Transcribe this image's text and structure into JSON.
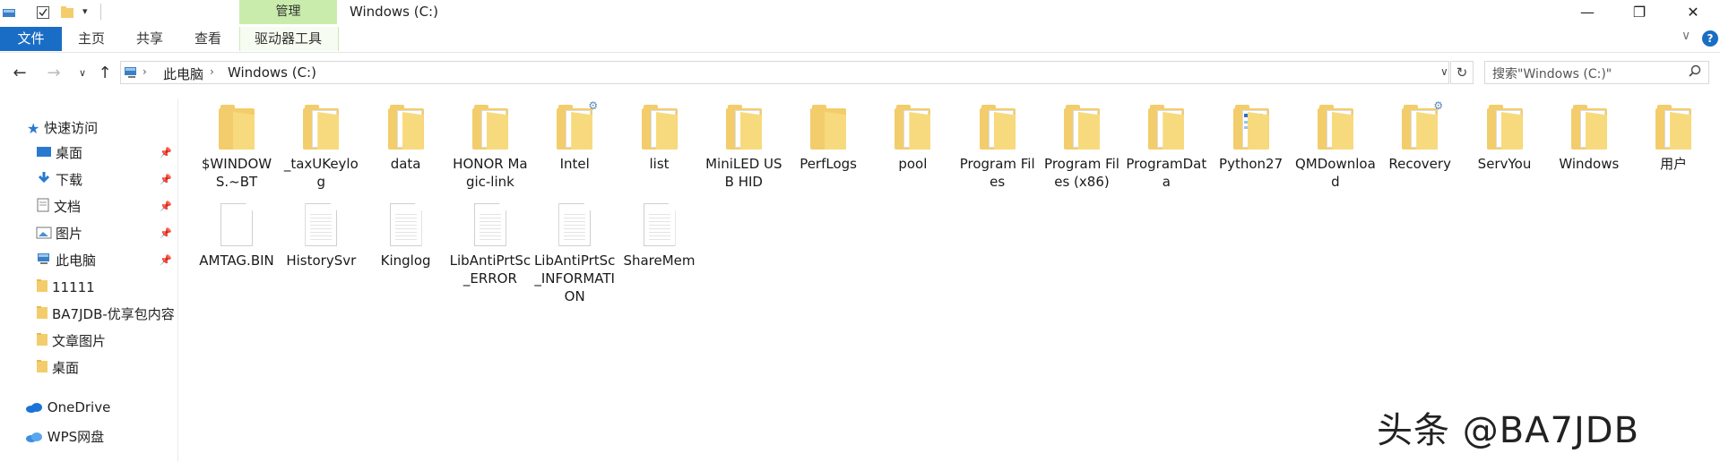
{
  "window": {
    "title": "Windows (C:)",
    "context_tab_header": "管理",
    "minimize": "—",
    "maximize": "❐",
    "close": "✕"
  },
  "ribbon": {
    "tabs": [
      "文件",
      "主页",
      "共享",
      "查看",
      "驱动器工具"
    ],
    "help": "?",
    "expand": "∨"
  },
  "address": {
    "path": [
      "此电脑",
      "Windows (C:)"
    ],
    "separator": "›",
    "search_placeholder": "搜索\"Windows (C:)\""
  },
  "nav_pane": {
    "quick_access": "快速访问",
    "items": [
      {
        "label": "桌面",
        "icon": "desktop-icon",
        "pinned": true
      },
      {
        "label": "下载",
        "icon": "download-icon",
        "pinned": true
      },
      {
        "label": "文档",
        "icon": "documents-icon",
        "pinned": true
      },
      {
        "label": "图片",
        "icon": "pictures-icon",
        "pinned": true
      },
      {
        "label": "此电脑",
        "icon": "this-pc-icon",
        "pinned": true
      },
      {
        "label": "11111",
        "icon": "folder-icon",
        "pinned": false
      },
      {
        "label": "BA7JDB-优享包内容",
        "icon": "folder-icon",
        "pinned": false
      },
      {
        "label": "文章图片",
        "icon": "folder-icon",
        "pinned": false
      },
      {
        "label": "桌面",
        "icon": "folder-icon",
        "pinned": false
      }
    ],
    "onedrive": "OneDrive",
    "wps": "WPS网盘"
  },
  "files_row1": [
    {
      "label": "$WINDOWS.~BT",
      "type": "folder-empty"
    },
    {
      "label": "_taxUKeylog",
      "type": "folder-doc"
    },
    {
      "label": "data",
      "type": "folder-doc"
    },
    {
      "label": "HONOR Magic-link",
      "type": "folder-doc"
    },
    {
      "label": "Intel",
      "type": "folder-gear"
    },
    {
      "label": "list",
      "type": "folder-doc"
    },
    {
      "label": "MiniLED USB HID",
      "type": "folder-doc"
    },
    {
      "label": "PerfLogs",
      "type": "folder-empty"
    },
    {
      "label": "pool",
      "type": "folder-doc"
    },
    {
      "label": "Program Files",
      "type": "folder-doc"
    },
    {
      "label": "Program Files (x86)",
      "type": "folder-doc"
    },
    {
      "label": "ProgramData",
      "type": "folder-doc"
    },
    {
      "label": "Python27",
      "type": "folder-blue"
    },
    {
      "label": "QMDownload",
      "type": "folder-doc"
    },
    {
      "label": "Recovery",
      "type": "folder-gear"
    },
    {
      "label": "ServYou",
      "type": "folder-doc"
    },
    {
      "label": "Windows",
      "type": "folder-doc"
    },
    {
      "label": "用户",
      "type": "folder-doc"
    }
  ],
  "files_row2": [
    {
      "label": "AMTAG.BIN",
      "type": "file-blank"
    },
    {
      "label": "HistorySvr",
      "type": "file-lines"
    },
    {
      "label": "Kinglog",
      "type": "file-lines"
    },
    {
      "label": "LibAntiPrtSc_ERROR",
      "type": "file-lines"
    },
    {
      "label": "LibAntiPrtSc_INFORMATION",
      "type": "file-lines"
    },
    {
      "label": "ShareMem",
      "type": "file-lines"
    }
  ],
  "watermark": "头条 @BA7JDB",
  "colors": {
    "file_tab": "#1a6dc4",
    "manage_tab": "#c9ecac",
    "folder": "#f3cd6b"
  }
}
